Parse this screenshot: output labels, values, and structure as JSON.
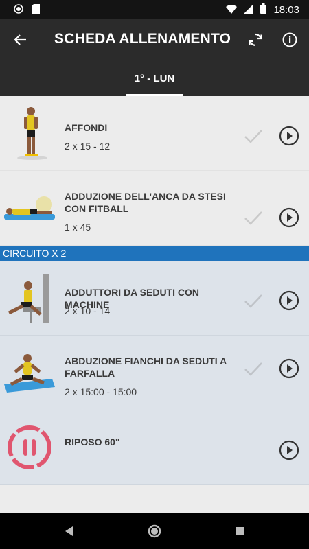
{
  "status_bar": {
    "time": "18:03"
  },
  "header": {
    "title": "SCHEDA ALLENAMENTO"
  },
  "tabs": [
    {
      "label": "1° - LUN"
    }
  ],
  "colors": {
    "app_bar": "#2b2b2b",
    "section_header": "#1f73bc",
    "circuit_bg": "#dde3ea",
    "rest_icon": "#e0566f"
  },
  "exercises": [
    {
      "name": "AFFONDI",
      "detail": "2 x 15 - 12",
      "completed": false
    },
    {
      "name": "ADDUZIONE DELL'ANCA DA STESI CON FITBALL",
      "detail": "1 x 45",
      "completed": false
    }
  ],
  "circuit": {
    "label": "CIRCUITO X 2",
    "items": [
      {
        "name": "ADDUTTORI DA SEDUTI CON MACHINE",
        "detail": "2 x 10 - 14",
        "completed": false
      },
      {
        "name": "ABDUZIONE FIANCHI DA SEDUTI A FARFALLA",
        "detail": "2 x 15:00 - 15:00",
        "completed": false
      },
      {
        "name": "RIPOSO 60\"",
        "icon": "pause-timer-icon"
      }
    ]
  }
}
